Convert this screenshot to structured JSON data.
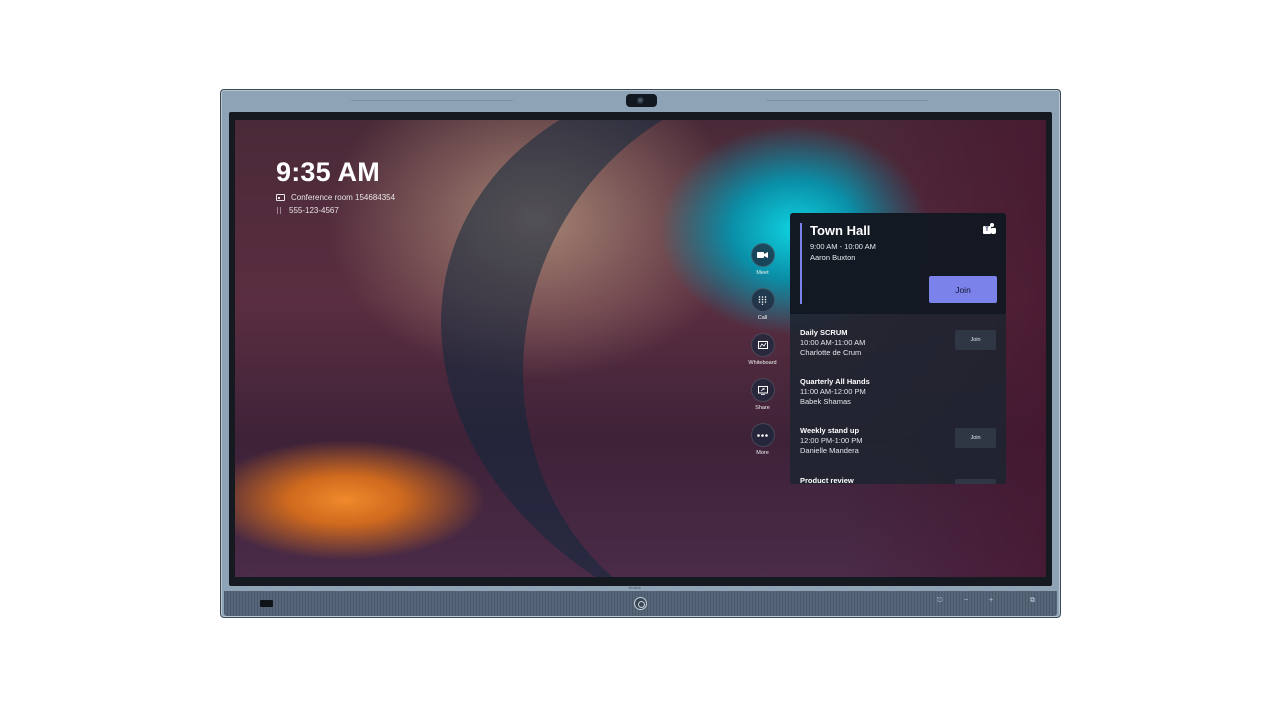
{
  "screen": {
    "clock": "9:35 AM",
    "room_name": "Conference room 154684354",
    "phone_number": "555-123-4567"
  },
  "device": {
    "brand": "Yealink"
  },
  "actions": [
    {
      "label": "Meet",
      "icon": "video-camera-icon"
    },
    {
      "label": "Call",
      "icon": "dialpad-icon"
    },
    {
      "label": "Whiteboard",
      "icon": "whiteboard-icon"
    },
    {
      "label": "Share",
      "icon": "share-screen-icon"
    },
    {
      "label": "More",
      "icon": "more-dots-icon"
    }
  ],
  "featured_meeting": {
    "title": "Town Hall",
    "time": "9:00 AM - 10:00 AM",
    "organizer": "Aaron Buxton",
    "join_label": "Join"
  },
  "meetings": [
    {
      "title": "Daily SCRUM",
      "time": "10:00 AM-11:00 AM",
      "organizer": "Charlotte de Crum",
      "join_label": "Join"
    },
    {
      "title": "Quarterly All Hands",
      "time": "11:00 AM-12:00 PM",
      "organizer": "Babek Shamas",
      "join_label": ""
    },
    {
      "title": "Weekly stand up",
      "time": "12:00 PM-1:00 PM",
      "organizer": "Danielle Mandera",
      "join_label": "Join"
    },
    {
      "title": "Product review",
      "time": "",
      "organizer": "",
      "join_label": ""
    }
  ],
  "colors": {
    "accent": "#7b83eb",
    "panel_bg": "#1e2430",
    "frame": "#8ea3b6"
  }
}
